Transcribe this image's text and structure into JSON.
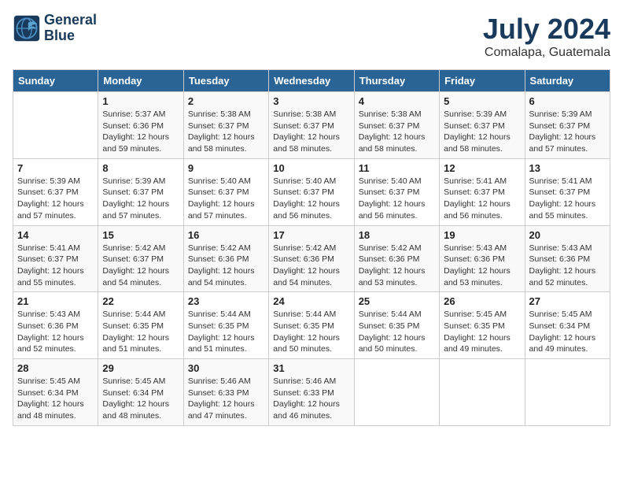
{
  "header": {
    "logo_line1": "General",
    "logo_line2": "Blue",
    "month_year": "July 2024",
    "location": "Comalapa, Guatemala"
  },
  "days_of_week": [
    "Sunday",
    "Monday",
    "Tuesday",
    "Wednesday",
    "Thursday",
    "Friday",
    "Saturday"
  ],
  "weeks": [
    [
      {
        "day": "",
        "info": ""
      },
      {
        "day": "1",
        "info": "Sunrise: 5:37 AM\nSunset: 6:36 PM\nDaylight: 12 hours\nand 59 minutes."
      },
      {
        "day": "2",
        "info": "Sunrise: 5:38 AM\nSunset: 6:37 PM\nDaylight: 12 hours\nand 58 minutes."
      },
      {
        "day": "3",
        "info": "Sunrise: 5:38 AM\nSunset: 6:37 PM\nDaylight: 12 hours\nand 58 minutes."
      },
      {
        "day": "4",
        "info": "Sunrise: 5:38 AM\nSunset: 6:37 PM\nDaylight: 12 hours\nand 58 minutes."
      },
      {
        "day": "5",
        "info": "Sunrise: 5:39 AM\nSunset: 6:37 PM\nDaylight: 12 hours\nand 58 minutes."
      },
      {
        "day": "6",
        "info": "Sunrise: 5:39 AM\nSunset: 6:37 PM\nDaylight: 12 hours\nand 57 minutes."
      }
    ],
    [
      {
        "day": "7",
        "info": "Sunrise: 5:39 AM\nSunset: 6:37 PM\nDaylight: 12 hours\nand 57 minutes."
      },
      {
        "day": "8",
        "info": "Sunrise: 5:39 AM\nSunset: 6:37 PM\nDaylight: 12 hours\nand 57 minutes."
      },
      {
        "day": "9",
        "info": "Sunrise: 5:40 AM\nSunset: 6:37 PM\nDaylight: 12 hours\nand 57 minutes."
      },
      {
        "day": "10",
        "info": "Sunrise: 5:40 AM\nSunset: 6:37 PM\nDaylight: 12 hours\nand 56 minutes."
      },
      {
        "day": "11",
        "info": "Sunrise: 5:40 AM\nSunset: 6:37 PM\nDaylight: 12 hours\nand 56 minutes."
      },
      {
        "day": "12",
        "info": "Sunrise: 5:41 AM\nSunset: 6:37 PM\nDaylight: 12 hours\nand 56 minutes."
      },
      {
        "day": "13",
        "info": "Sunrise: 5:41 AM\nSunset: 6:37 PM\nDaylight: 12 hours\nand 55 minutes."
      }
    ],
    [
      {
        "day": "14",
        "info": "Sunrise: 5:41 AM\nSunset: 6:37 PM\nDaylight: 12 hours\nand 55 minutes."
      },
      {
        "day": "15",
        "info": "Sunrise: 5:42 AM\nSunset: 6:37 PM\nDaylight: 12 hours\nand 54 minutes."
      },
      {
        "day": "16",
        "info": "Sunrise: 5:42 AM\nSunset: 6:36 PM\nDaylight: 12 hours\nand 54 minutes."
      },
      {
        "day": "17",
        "info": "Sunrise: 5:42 AM\nSunset: 6:36 PM\nDaylight: 12 hours\nand 54 minutes."
      },
      {
        "day": "18",
        "info": "Sunrise: 5:42 AM\nSunset: 6:36 PM\nDaylight: 12 hours\nand 53 minutes."
      },
      {
        "day": "19",
        "info": "Sunrise: 5:43 AM\nSunset: 6:36 PM\nDaylight: 12 hours\nand 53 minutes."
      },
      {
        "day": "20",
        "info": "Sunrise: 5:43 AM\nSunset: 6:36 PM\nDaylight: 12 hours\nand 52 minutes."
      }
    ],
    [
      {
        "day": "21",
        "info": "Sunrise: 5:43 AM\nSunset: 6:36 PM\nDaylight: 12 hours\nand 52 minutes."
      },
      {
        "day": "22",
        "info": "Sunrise: 5:44 AM\nSunset: 6:35 PM\nDaylight: 12 hours\nand 51 minutes."
      },
      {
        "day": "23",
        "info": "Sunrise: 5:44 AM\nSunset: 6:35 PM\nDaylight: 12 hours\nand 51 minutes."
      },
      {
        "day": "24",
        "info": "Sunrise: 5:44 AM\nSunset: 6:35 PM\nDaylight: 12 hours\nand 50 minutes."
      },
      {
        "day": "25",
        "info": "Sunrise: 5:44 AM\nSunset: 6:35 PM\nDaylight: 12 hours\nand 50 minutes."
      },
      {
        "day": "26",
        "info": "Sunrise: 5:45 AM\nSunset: 6:35 PM\nDaylight: 12 hours\nand 49 minutes."
      },
      {
        "day": "27",
        "info": "Sunrise: 5:45 AM\nSunset: 6:34 PM\nDaylight: 12 hours\nand 49 minutes."
      }
    ],
    [
      {
        "day": "28",
        "info": "Sunrise: 5:45 AM\nSunset: 6:34 PM\nDaylight: 12 hours\nand 48 minutes."
      },
      {
        "day": "29",
        "info": "Sunrise: 5:45 AM\nSunset: 6:34 PM\nDaylight: 12 hours\nand 48 minutes."
      },
      {
        "day": "30",
        "info": "Sunrise: 5:46 AM\nSunset: 6:33 PM\nDaylight: 12 hours\nand 47 minutes."
      },
      {
        "day": "31",
        "info": "Sunrise: 5:46 AM\nSunset: 6:33 PM\nDaylight: 12 hours\nand 46 minutes."
      },
      {
        "day": "",
        "info": ""
      },
      {
        "day": "",
        "info": ""
      },
      {
        "day": "",
        "info": ""
      }
    ]
  ]
}
